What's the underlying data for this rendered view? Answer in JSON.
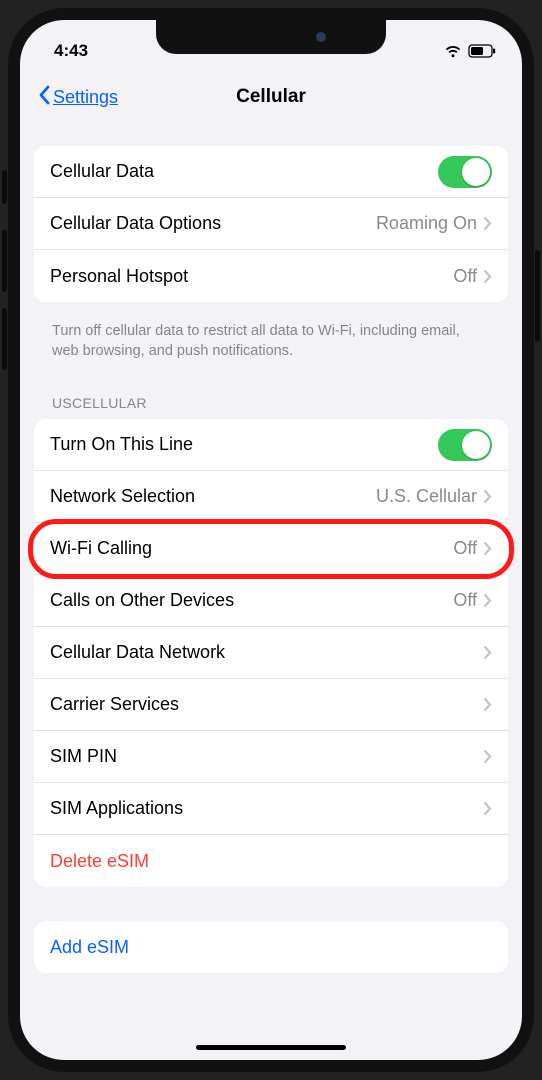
{
  "status": {
    "time": "4:43"
  },
  "nav": {
    "back": "Settings",
    "title": "Cellular"
  },
  "group1": {
    "cellular_data": {
      "label": "Cellular Data",
      "on": true
    },
    "data_options": {
      "label": "Cellular Data Options",
      "value": "Roaming On"
    },
    "hotspot": {
      "label": "Personal Hotspot",
      "value": "Off"
    },
    "footer": "Turn off cellular data to restrict all data to Wi-Fi, including email, web browsing, and push notifications."
  },
  "carrier_header": "USCELLULAR",
  "group2": {
    "turn_on_line": {
      "label": "Turn On This Line",
      "on": true
    },
    "network_sel": {
      "label": "Network Selection",
      "value": "U.S. Cellular"
    },
    "wifi_calling": {
      "label": "Wi-Fi Calling",
      "value": "Off"
    },
    "other_devices": {
      "label": "Calls on Other Devices",
      "value": "Off"
    },
    "data_network": {
      "label": "Cellular Data Network"
    },
    "carrier_svc": {
      "label": "Carrier Services"
    },
    "sim_pin": {
      "label": "SIM PIN"
    },
    "sim_apps": {
      "label": "SIM Applications"
    },
    "delete_esim": {
      "label": "Delete eSIM"
    }
  },
  "group3": {
    "add_esim": {
      "label": "Add eSIM"
    }
  },
  "highlight_target": "wifi-calling-row"
}
